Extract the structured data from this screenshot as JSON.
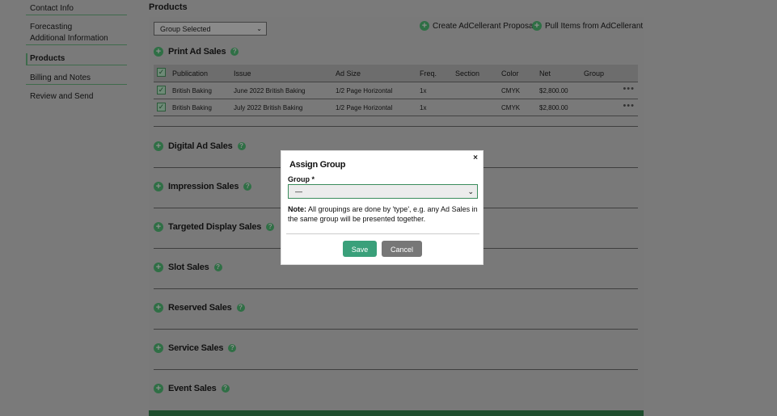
{
  "sidebar": {
    "items": [
      {
        "label": "Contact Info"
      },
      {
        "label": "Forecasting",
        "sub": "Additional Information"
      },
      {
        "label": "Products"
      },
      {
        "label": "Billing and Notes"
      },
      {
        "label": "Review and Send"
      }
    ]
  },
  "main": {
    "title": "Products",
    "group_select": "Group Selected",
    "create_link": "Create AdCellerant Proposal",
    "pull_link": "Pull Items from AdCellerant"
  },
  "print_ad_sales": {
    "title": "Print Ad Sales",
    "columns": [
      "Publication",
      "Issue",
      "Ad Size",
      "Freq.",
      "Section",
      "Color",
      "Net",
      "Group"
    ],
    "rows": [
      {
        "publication": "British Baking",
        "issue": "June 2022 British Baking",
        "ad_size": "1/2 Page Horizontal",
        "freq": "1x",
        "section": "",
        "color": "CMYK",
        "net": "$2,800.00",
        "group": ""
      },
      {
        "publication": "British Baking",
        "issue": "July 2022 British Baking",
        "ad_size": "1/2 Page Horizontal",
        "freq": "1x",
        "section": "",
        "color": "CMYK",
        "net": "$2,800.00",
        "group": ""
      }
    ]
  },
  "sections": [
    {
      "title": "Digital Ad Sales"
    },
    {
      "title": "Impression Sales"
    },
    {
      "title": "Targeted Display Sales"
    },
    {
      "title": "Slot Sales"
    },
    {
      "title": "Reserved Sales"
    },
    {
      "title": "Service Sales"
    },
    {
      "title": "Event Sales"
    }
  ],
  "modal": {
    "title": "Assign Group",
    "close": "×",
    "group_label": "Group *",
    "group_value": "—",
    "note_label": "Note:",
    "note_text": "All groupings are done by 'type', e.g. any Ad Sales in the same group will be presented together.",
    "save": "Save",
    "cancel": "Cancel"
  },
  "icons": {
    "plus": "plus-circle-icon",
    "help": "question-circle-icon",
    "more": "more-dots-icon",
    "chevron": "chevron-down-icon"
  },
  "colors": {
    "accent": "#3aa07a",
    "brand_green": "#2f6f45",
    "cancel_gray": "#777777"
  }
}
